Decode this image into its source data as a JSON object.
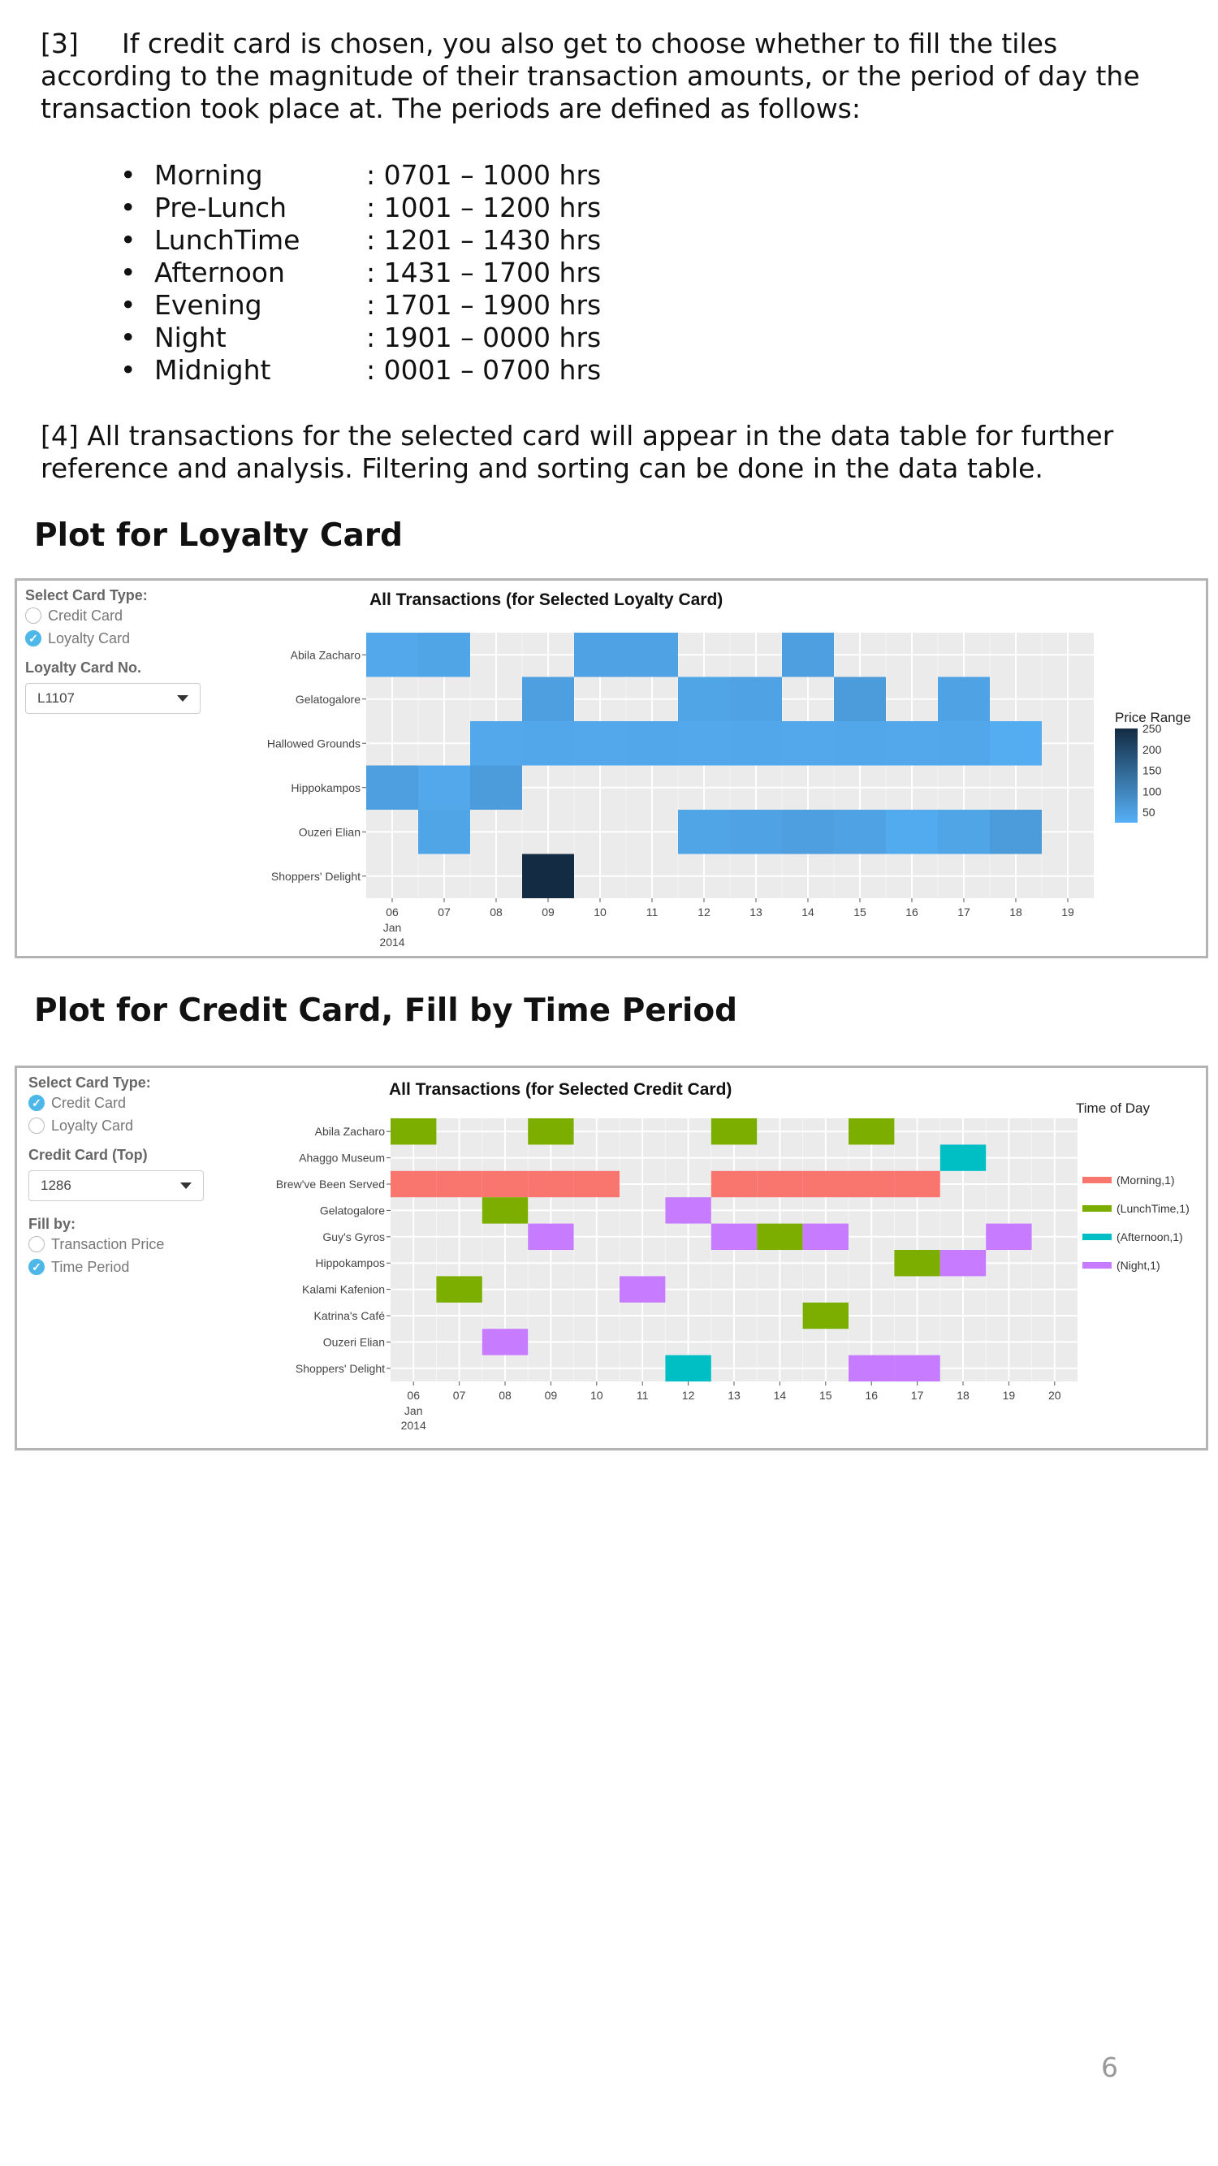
{
  "para3": {
    "number": "[3]",
    "text": "If credit card is chosen, you also get to choose whether to fill the tiles according to the magnitude of their transaction amounts, or the period of day the transaction took place at. The periods are defined as follows:"
  },
  "periods": [
    {
      "name": "Morning",
      "range": ": 0701 – 1000 hrs"
    },
    {
      "name": "Pre-Lunch",
      "range": ": 1001 – 1200 hrs"
    },
    {
      "name": "LunchTime",
      "range": ": 1201 – 1430 hrs"
    },
    {
      "name": "Afternoon",
      "range": ": 1431 – 1700 hrs"
    },
    {
      "name": "Evening",
      "range": ": 1701 – 1900 hrs"
    },
    {
      "name": "Night",
      "range": ": 1901 – 0000 hrs"
    },
    {
      "name": "Midnight",
      "range": ": 0001 – 0700 hrs"
    }
  ],
  "para4": "[4] All transactions for the selected card will appear in the data table for further reference and analysis. Filtering and sorting can be done in the data table.",
  "loyalty_heading": "Plot for Loyalty Card",
  "credit_heading": "Plot for Credit Card, Fill by Time Period",
  "page_number": "6",
  "bullet": "•",
  "loyalty_panel": {
    "card_type_label": "Select Card Type:",
    "opt_credit": "Credit Card",
    "opt_loyalty": "Loyalty Card",
    "selected": "Loyalty Card",
    "card_no_label": "Loyalty Card No.",
    "card_no_value": "L1107"
  },
  "credit_panel": {
    "card_type_label": "Select Card Type:",
    "opt_credit": "Credit Card",
    "opt_loyalty": "Loyalty Card",
    "selected": "Credit Card",
    "card_label": "Credit Card (Top)",
    "card_value": "1286",
    "fill_label": "Fill by:",
    "opt_price": "Transaction Price",
    "opt_time": "Time Period",
    "fill_selected": "Time Period"
  },
  "chart_data": [
    {
      "type": "heatmap",
      "title": "All Transactions (for Selected Loyalty Card)",
      "x_ticks": [
        "06",
        "07",
        "08",
        "09",
        "10",
        "11",
        "12",
        "13",
        "14",
        "15",
        "16",
        "17",
        "18",
        "19"
      ],
      "x_tick_sub": [
        "Jan",
        "2014"
      ],
      "y_categories": [
        "Abila Zacharo",
        "Gelatogalore",
        "Hallowed Grounds",
        "Hippokampos",
        "Ouzeri Elian",
        "Shoppers' Delight"
      ],
      "legend_title": "Price Range",
      "legend_ticks": [
        250,
        200,
        150,
        100,
        50
      ],
      "color_range": [
        "#56b1f7",
        "#132b43"
      ],
      "value_range": [
        25,
        250
      ],
      "cells": [
        {
          "y": "Abila Zacharo",
          "day": 6,
          "value": 40
        },
        {
          "y": "Abila Zacharo",
          "day": 7,
          "value": 45
        },
        {
          "y": "Abila Zacharo",
          "day": 10,
          "value": 50
        },
        {
          "y": "Abila Zacharo",
          "day": 11,
          "value": 48
        },
        {
          "y": "Abila Zacharo",
          "day": 14,
          "value": 55
        },
        {
          "y": "Gelatogalore",
          "day": 9,
          "value": 55
        },
        {
          "y": "Gelatogalore",
          "day": 12,
          "value": 45
        },
        {
          "y": "Gelatogalore",
          "day": 13,
          "value": 48
        },
        {
          "y": "Gelatogalore",
          "day": 15,
          "value": 60
        },
        {
          "y": "Gelatogalore",
          "day": 17,
          "value": 50
        },
        {
          "y": "Hallowed Grounds",
          "day": 8,
          "value": 40
        },
        {
          "y": "Hallowed Grounds",
          "day": 9,
          "value": 42
        },
        {
          "y": "Hallowed Grounds",
          "day": 10,
          "value": 40
        },
        {
          "y": "Hallowed Grounds",
          "day": 11,
          "value": 42
        },
        {
          "y": "Hallowed Grounds",
          "day": 12,
          "value": 40
        },
        {
          "y": "Hallowed Grounds",
          "day": 13,
          "value": 42
        },
        {
          "y": "Hallowed Grounds",
          "day": 14,
          "value": 40
        },
        {
          "y": "Hallowed Grounds",
          "day": 15,
          "value": 42
        },
        {
          "y": "Hallowed Grounds",
          "day": 16,
          "value": 40
        },
        {
          "y": "Hallowed Grounds",
          "day": 17,
          "value": 42
        },
        {
          "y": "Hallowed Grounds",
          "day": 18,
          "value": 32
        },
        {
          "y": "Hippokampos",
          "day": 6,
          "value": 55
        },
        {
          "y": "Hippokampos",
          "day": 7,
          "value": 40
        },
        {
          "y": "Hippokampos",
          "day": 8,
          "value": 60
        },
        {
          "y": "Ouzeri Elian",
          "day": 7,
          "value": 45
        },
        {
          "y": "Ouzeri Elian",
          "day": 12,
          "value": 45
        },
        {
          "y": "Ouzeri Elian",
          "day": 13,
          "value": 48
        },
        {
          "y": "Ouzeri Elian",
          "day": 14,
          "value": 55
        },
        {
          "y": "Ouzeri Elian",
          "day": 15,
          "value": 50
        },
        {
          "y": "Ouzeri Elian",
          "day": 16,
          "value": 35
        },
        {
          "y": "Ouzeri Elian",
          "day": 17,
          "value": 45
        },
        {
          "y": "Ouzeri Elian",
          "day": 18,
          "value": 60
        },
        {
          "y": "Shoppers' Delight",
          "day": 9,
          "value": 250
        }
      ]
    },
    {
      "type": "heatmap",
      "title": "All Transactions (for Selected Credit Card)",
      "x_ticks": [
        "06",
        "07",
        "08",
        "09",
        "10",
        "11",
        "12",
        "13",
        "14",
        "15",
        "16",
        "17",
        "18",
        "19",
        "20"
      ],
      "x_tick_sub": [
        "Jan",
        "2014"
      ],
      "y_categories": [
        "Abila Zacharo",
        "Ahaggo Museum",
        "Brew've Been Served",
        "Gelatogalore",
        "Guy's Gyros",
        "Hippokampos",
        "Kalami Kafenion",
        "Katrina's Café",
        "Ouzeri Elian",
        "Shoppers' Delight"
      ],
      "legend_title": "Time of Day",
      "legend": [
        {
          "key": "Morning",
          "label": "(Morning,1)",
          "color": "#f8766d"
        },
        {
          "key": "LunchTime",
          "label": "(LunchTime,1)",
          "color": "#7cae00"
        },
        {
          "key": "Afternoon",
          "label": "(Afternoon,1)",
          "color": "#00bfc4"
        },
        {
          "key": "Night",
          "label": "(Night,1)",
          "color": "#c77cff"
        }
      ],
      "cells": [
        {
          "y": "Abila Zacharo",
          "day": 6,
          "period": "LunchTime"
        },
        {
          "y": "Abila Zacharo",
          "day": 9,
          "period": "LunchTime"
        },
        {
          "y": "Abila Zacharo",
          "day": 13,
          "period": "LunchTime"
        },
        {
          "y": "Abila Zacharo",
          "day": 16,
          "period": "LunchTime"
        },
        {
          "y": "Ahaggo Museum",
          "day": 18,
          "period": "Afternoon"
        },
        {
          "y": "Brew've Been Served",
          "day": 6,
          "period": "Morning"
        },
        {
          "y": "Brew've Been Served",
          "day": 7,
          "period": "Morning"
        },
        {
          "y": "Brew've Been Served",
          "day": 8,
          "period": "Morning"
        },
        {
          "y": "Brew've Been Served",
          "day": 9,
          "period": "Morning"
        },
        {
          "y": "Brew've Been Served",
          "day": 10,
          "period": "Morning"
        },
        {
          "y": "Brew've Been Served",
          "day": 13,
          "period": "Morning"
        },
        {
          "y": "Brew've Been Served",
          "day": 14,
          "period": "Morning"
        },
        {
          "y": "Brew've Been Served",
          "day": 15,
          "period": "Morning"
        },
        {
          "y": "Brew've Been Served",
          "day": 16,
          "period": "Morning"
        },
        {
          "y": "Brew've Been Served",
          "day": 17,
          "period": "Morning"
        },
        {
          "y": "Gelatogalore",
          "day": 8,
          "period": "LunchTime"
        },
        {
          "y": "Gelatogalore",
          "day": 12,
          "period": "Night"
        },
        {
          "y": "Guy's Gyros",
          "day": 9,
          "period": "Night"
        },
        {
          "y": "Guy's Gyros",
          "day": 13,
          "period": "Night"
        },
        {
          "y": "Guy's Gyros",
          "day": 14,
          "period": "LunchTime"
        },
        {
          "y": "Guy's Gyros",
          "day": 15,
          "period": "Night"
        },
        {
          "y": "Guy's Gyros",
          "day": 19,
          "period": "Night"
        },
        {
          "y": "Hippokampos",
          "day": 17,
          "period": "LunchTime"
        },
        {
          "y": "Hippokampos",
          "day": 18,
          "period": "Night"
        },
        {
          "y": "Kalami Kafenion",
          "day": 7,
          "period": "LunchTime"
        },
        {
          "y": "Kalami Kafenion",
          "day": 11,
          "period": "Night"
        },
        {
          "y": "Katrina's Café",
          "day": 15,
          "period": "LunchTime"
        },
        {
          "y": "Ouzeri Elian",
          "day": 8,
          "period": "Night"
        },
        {
          "y": "Shoppers' Delight",
          "day": 12,
          "period": "Afternoon"
        },
        {
          "y": "Shoppers' Delight",
          "day": 16,
          "period": "Night"
        },
        {
          "y": "Shoppers' Delight",
          "day": 17,
          "period": "Night"
        }
      ]
    }
  ]
}
